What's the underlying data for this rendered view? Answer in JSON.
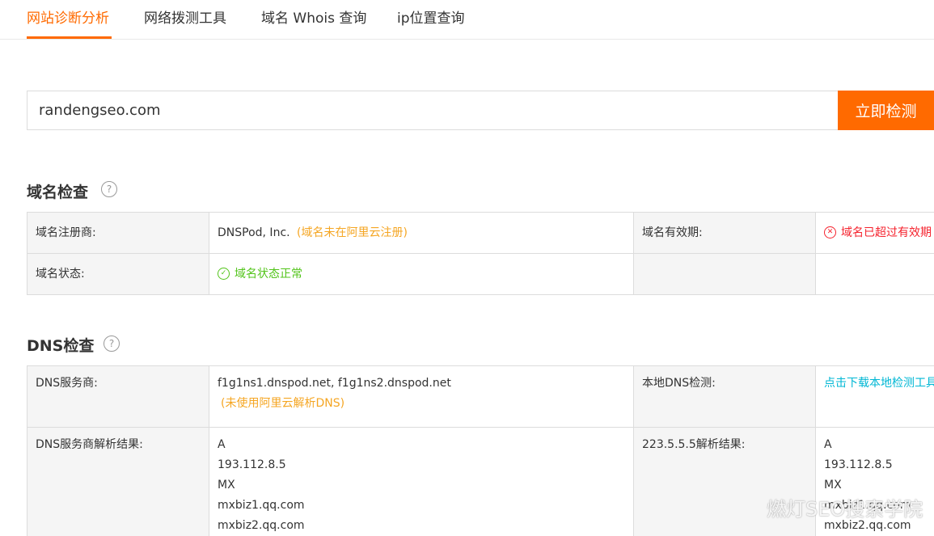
{
  "tabs": [
    {
      "label": "网站诊断分析",
      "active": true
    },
    {
      "label": "网络拨测工具",
      "active": false
    },
    {
      "label": "域名 Whois 查询",
      "active": false
    },
    {
      "label": "ip位置查询",
      "active": false
    }
  ],
  "search": {
    "value": "randengseo.com",
    "button_label": "立即检测"
  },
  "domain_check": {
    "title": "域名检查",
    "registrar_label": "域名注册商:",
    "registrar_value": "DNSPod, Inc.",
    "registrar_note": "(域名未在阿里云注册)",
    "validity_label": "域名有效期:",
    "validity_value": "域名已超过有效期",
    "status_label": "域名状态:",
    "status_value": "域名状态正常"
  },
  "dns_check": {
    "title": "DNS检查",
    "provider_label": "DNS服务商:",
    "provider_value": "f1g1ns1.dnspod.net, f1g1ns2.dnspod.net",
    "provider_note": "(未使用阿里云解析DNS)",
    "local_label": "本地DNS检测:",
    "local_value": "点击下载本地检测工具",
    "result_label": "DNS服务商解析结果:",
    "result_lines": [
      "A",
      "193.112.8.5",
      "MX",
      "mxbiz1.qq.com",
      "mxbiz2.qq.com"
    ],
    "public_label": "223.5.5.5解析结果:",
    "public_lines": [
      "A",
      "193.112.8.5",
      "MX",
      "mxbiz1.qq.com",
      "mxbiz2.qq.com"
    ]
  },
  "watermark": "燃灯SEO搜索学院",
  "colors": {
    "accent": "#ff6a00",
    "note": "#f5a623",
    "ok": "#52c41a",
    "error": "#f5222d",
    "link": "#00b7d4"
  }
}
